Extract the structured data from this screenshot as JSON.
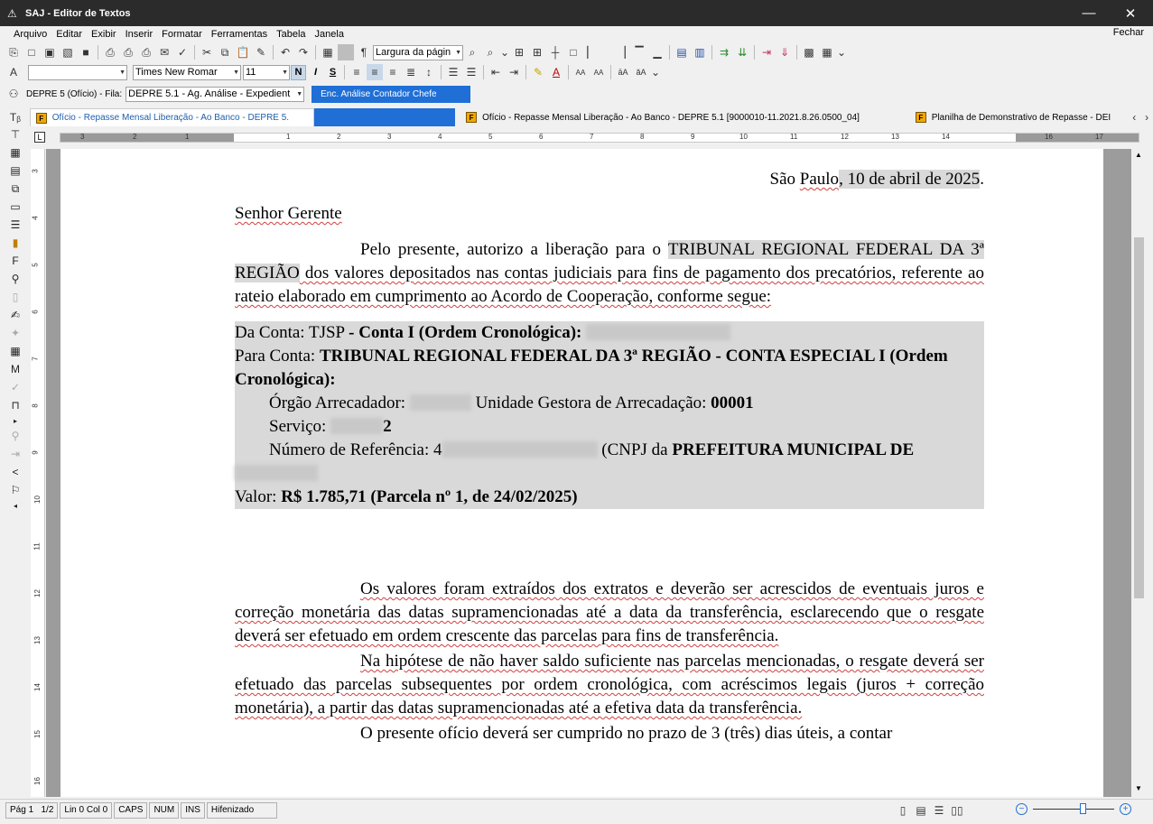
{
  "window": {
    "title": "SAJ - Editor de Textos",
    "minimize_symbol": "—",
    "close_symbol": "✕"
  },
  "menu": {
    "items": [
      {
        "label": "Arquivo"
      },
      {
        "label": "Editar"
      },
      {
        "label": "Exibir"
      },
      {
        "label": "Inserir"
      },
      {
        "label": "Formatar"
      },
      {
        "label": "Ferramentas"
      },
      {
        "label": "Tabela"
      },
      {
        "label": "Janela"
      }
    ],
    "fechar": "Fechar"
  },
  "toolbar1": {
    "zoom_combo": "Largura da págin"
  },
  "toolbar2": {
    "style_combo": "",
    "font_combo": "Times New Romar",
    "size_combo": "11",
    "bold": "N",
    "italic": "I",
    "underline": "S"
  },
  "toolbar3": {
    "queue_label": "DEPRE 5 (Ofício) - Fila:",
    "queue_combo": "DEPRE 5.1 - Ag. Análise - Expedient",
    "action_button": "Enc. Análise Contador Chefe"
  },
  "tabs": [
    {
      "label": "Ofício - Repasse Mensal Liberação - Ao Banco - DEPRE 5."
    },
    {
      "label": "Ofício - Repasse Mensal Liberação - Ao Banco - DEPRE 5.1 [9000010-11.2021.8.26.0500_04]"
    },
    {
      "label": "Planilha de Demonstrativo de Repasse - DEI"
    }
  ],
  "ruler": {
    "labels": [
      "3",
      "2",
      "1",
      "1",
      "2",
      "3",
      "4",
      "5",
      "6",
      "7",
      "8",
      "9",
      "10",
      "11",
      "12",
      "13",
      "14",
      "16",
      "17"
    ]
  },
  "vruler": {
    "labels": [
      "3",
      "4",
      "5",
      "6",
      "7",
      "8",
      "9",
      "10",
      "11",
      "12",
      "13",
      "14",
      "15",
      "16"
    ]
  },
  "document": {
    "date_line_prefix": "São ",
    "date_city": "Paulo",
    "date_rest": ", 10 de abril de 2025",
    "date_end": ".",
    "salutation": "Senhor Gerente",
    "p1_a": "Pelo presente, autorizo a liberação para o ",
    "p1_b": "TRIBUNAL REGIONAL FEDERAL DA 3ª REGIÃO",
    "p1_c": " dos valores depositados nas contas judiciais para fins de pagamento dos precatórios, referente ao rateio elaborado em cumprimento ao Acordo de Cooperação, conforme segue:",
    "da_conta_label": "Da Conta: TJSP ",
    "da_conta_bold": "- Conta I (Ordem Cronológica):",
    "para_conta_label": "Para Conta: ",
    "para_conta_bold": "TRIBUNAL REGIONAL FEDERAL DA 3ª REGIÃO - CONTA ESPECIAL I (Ordem Cronológica):",
    "orgao_label": "Órgão Arrecadador: ",
    "ug_label": " Unidade Gestora de Arrecadação: ",
    "ug_value": "00001",
    "servico_label": "Serviço: ",
    "servico_value": "2",
    "ref_label": "Número de Referência: ",
    "ref_first": "4",
    "cnpj_label": " (CNPJ da ",
    "cnpj_bold": "PREFEITURA MUNICIPAL DE",
    "valor_label": "Valor: ",
    "valor_bold": "R$ 1.785,71 (Parcela nº 1, de 24/02/2025)",
    "p2": "Os valores foram extraídos dos extratos e deverão ser acrescidos de eventuais juros e correção monetária das datas supramencionadas até a data da transferência, esclarecendo que o resgate deverá ser efetuado em ordem crescente das parcelas para fins de transferência.",
    "p3": "Na hipótese de não haver saldo suficiente nas parcelas mencionadas, o resgate deverá ser efetuado das parcelas subsequentes por ordem cronológica, com acréscimos legais (juros + correção monetária), a partir das datas supramencionadas até a efetiva data da transferência.",
    "p4": "O presente ofício deverá ser cumprido no prazo de 3 (três) dias úteis, a contar"
  },
  "status": {
    "page_label": "Pág 1",
    "page_count": "1/2",
    "position": "Lin 0  Col 0",
    "caps": "CAPS",
    "num": "NUM",
    "ins": "INS",
    "hyphen": "Hifenizado"
  }
}
